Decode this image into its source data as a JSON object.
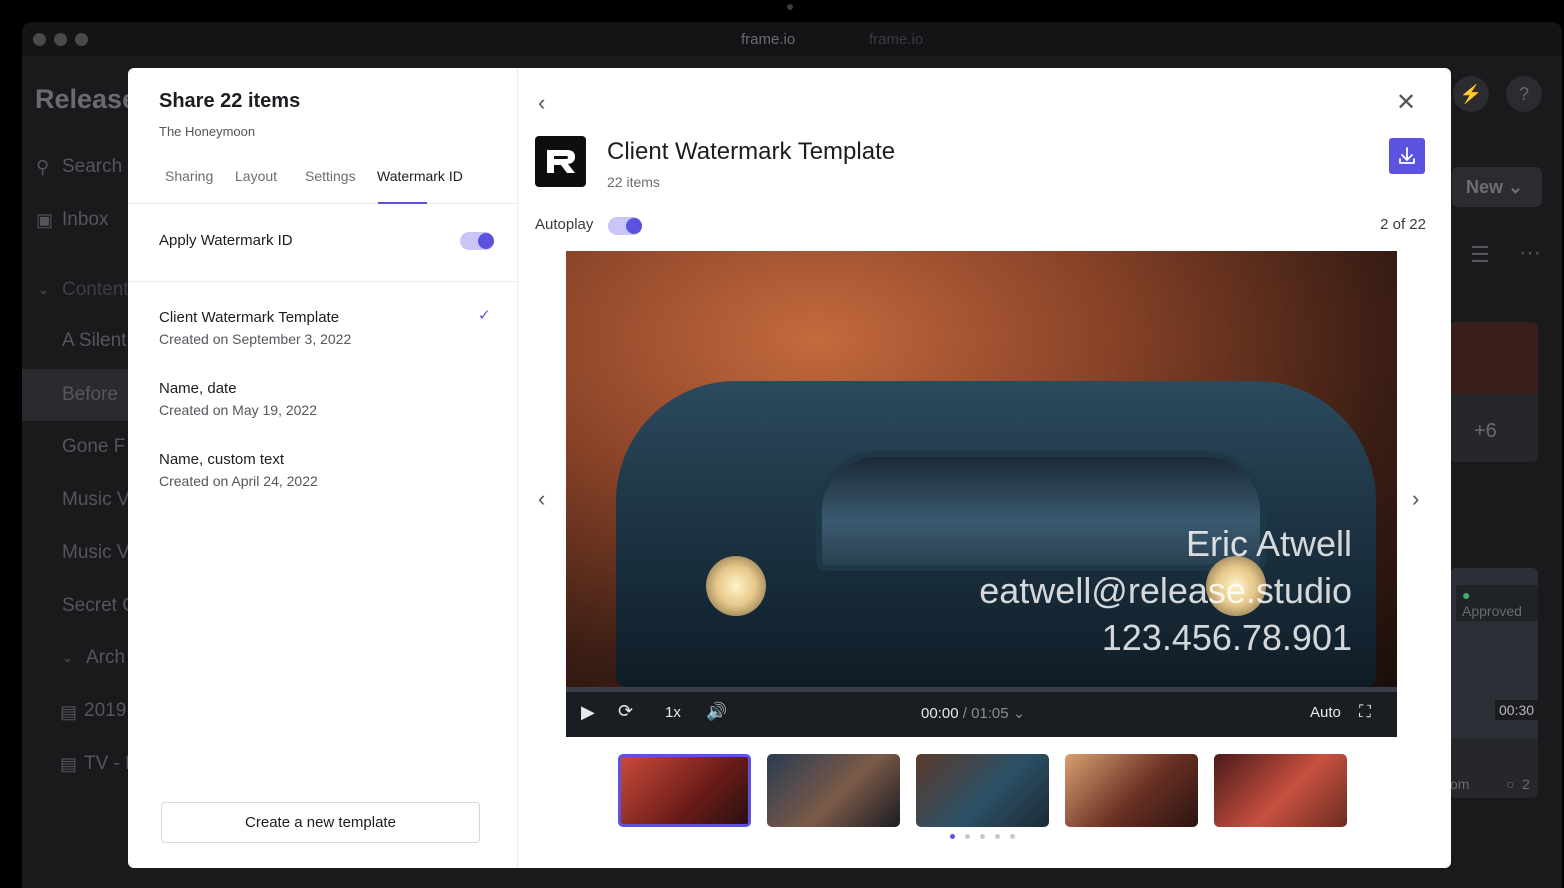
{
  "window": {
    "tab_active": "frame.io",
    "tab_inactive": "frame.io"
  },
  "background_app": {
    "brand": "Release",
    "nav": [
      {
        "label": "Search",
        "icon": "search-icon"
      },
      {
        "label": "Inbox",
        "icon": "inbox-icon"
      },
      {
        "label": "Content",
        "icon": "chevron-down-icon"
      },
      {
        "label": "A Silent"
      },
      {
        "label": "Before"
      },
      {
        "label": "Gone F"
      },
      {
        "label": "Music V"
      },
      {
        "label": "Music V"
      },
      {
        "label": "Secret C"
      },
      {
        "label": "Arch",
        "icon": "chevron-down-icon"
      },
      {
        "label": "2019",
        "icon": "archive-icon"
      },
      {
        "label": "TV - F",
        "icon": "archive-icon"
      }
    ],
    "new_button": "New",
    "plus_count": "+6",
    "approved_badge": "Approved",
    "duration": "00:30",
    "comment_count": "2",
    "partial_text": "om"
  },
  "share_panel": {
    "title": "Share 22 items",
    "subtitle": "The Honeymoon",
    "tabs": [
      {
        "label": "Sharing"
      },
      {
        "label": "Layout"
      },
      {
        "label": "Settings"
      },
      {
        "label": "Watermark ID"
      }
    ],
    "active_tab": "Watermark ID",
    "apply_label": "Apply Watermark ID",
    "apply_enabled": true,
    "templates": [
      {
        "name": "Client Watermark Template",
        "date": "Created on September 3, 2022",
        "selected": true
      },
      {
        "name": "Name, date",
        "date": "Created on May 19, 2022",
        "selected": false
      },
      {
        "name": "Name, custom text",
        "date": "Created on April 24, 2022",
        "selected": false
      }
    ],
    "create_button": "Create a new template"
  },
  "preview": {
    "title": "Client Watermark Template",
    "count": "22 items",
    "autoplay_label": "Autoplay",
    "autoplay_enabled": true,
    "counter": "2 of 22",
    "watermark": {
      "name": "Eric Atwell",
      "email": "eatwell@release.studio",
      "id": "123.456.78.901"
    },
    "player": {
      "speed": "1x",
      "current_time": "00:00",
      "total_time": "01:05",
      "quality": "Auto"
    },
    "thumbnails": [
      {
        "name": "thumb-1",
        "selected": true
      },
      {
        "name": "thumb-2",
        "selected": false
      },
      {
        "name": "thumb-3",
        "selected": false
      },
      {
        "name": "thumb-4",
        "selected": false
      },
      {
        "name": "thumb-5",
        "selected": false
      }
    ],
    "dots_active_index": 0
  },
  "colors": {
    "accent": "#5b53e0",
    "toggle_track": "#c9c6f7",
    "background": "#1a1a1c"
  }
}
